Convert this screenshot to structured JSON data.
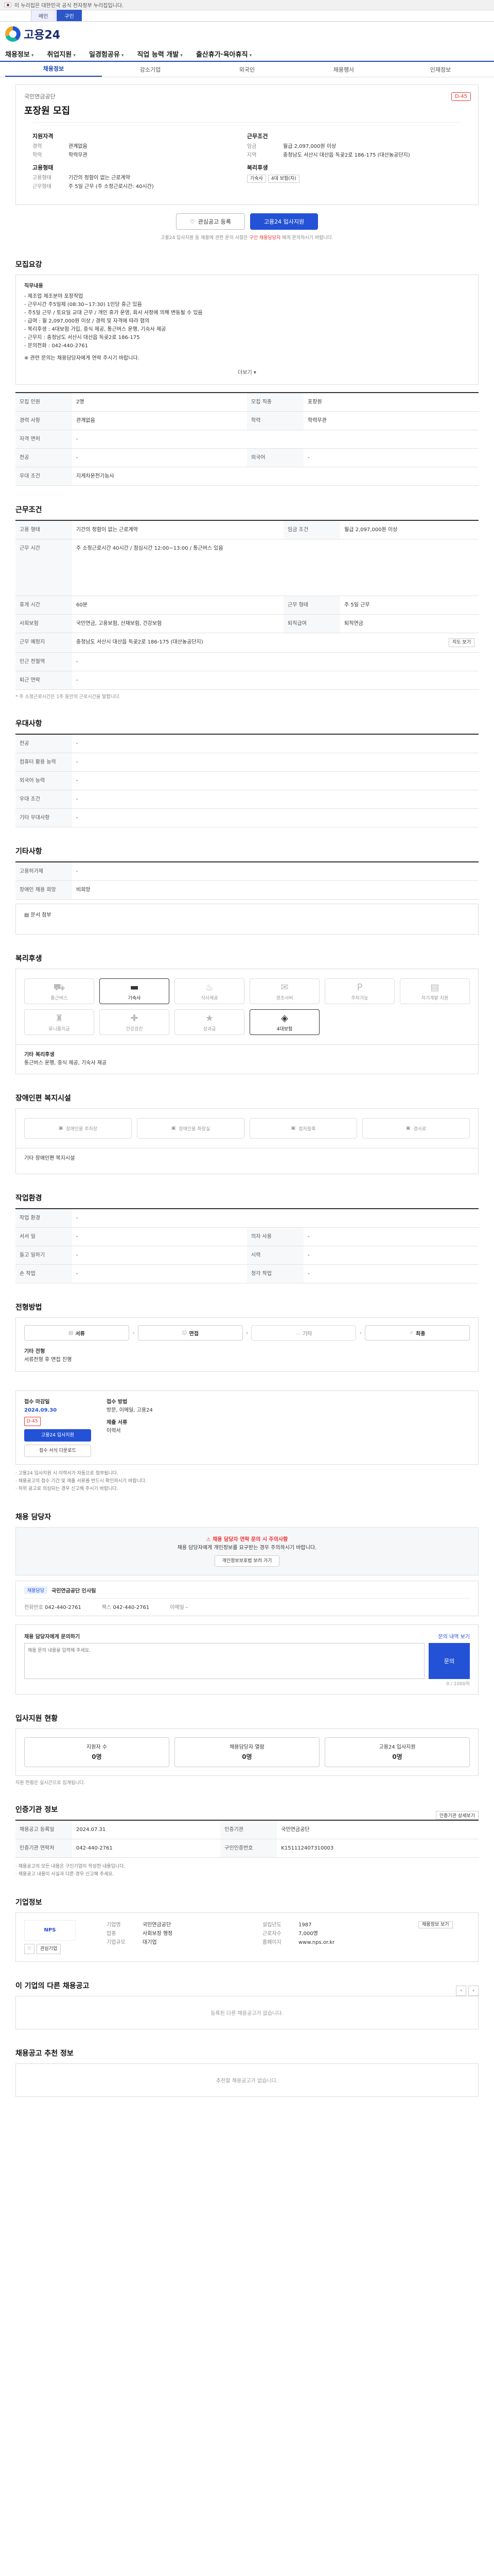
{
  "gov_banner": "이 누리집은 대한민국 공식 전자정부 누리집입니다.",
  "browser_tabs": [
    "메인",
    "구인"
  ],
  "logo": {
    "text": "고용24"
  },
  "gnb": [
    "채용정보",
    "취업지원",
    "일경험공유",
    "직업 능력 개발",
    "출산휴가·육아휴직"
  ],
  "subnav": [
    "채용정보",
    "강소기업",
    "외국인",
    "채용행사",
    "인재정보"
  ],
  "job": {
    "company": "국민연금공단",
    "title": "포장원 모집",
    "badge": "D-45",
    "summary_left_title": "지원자격",
    "summary_left": [
      {
        "k": "경력",
        "v": "관계없음"
      },
      {
        "k": "학력",
        "v": "학력무관"
      }
    ],
    "summary_right_title": "근무조건",
    "summary_right": [
      {
        "k": "임금",
        "v": "월급 2,097,000원 이상"
      },
      {
        "k": "지역",
        "v": "충청남도 서산시 대산읍 독곶2로 186-175 (대산농공단지)"
      }
    ],
    "summary_left2_title": "고용형태",
    "summary_left2": [
      {
        "k": "고용형태",
        "v": "기간의 정함이 없는 근로계약"
      },
      {
        "k": "근무형태",
        "v": "주 5일 근무 (주 소정근로시간: 40시간)"
      }
    ],
    "summary_right2_title": "복리후생",
    "summary_right2": [
      {
        "k": "",
        "v": "기숙사"
      },
      {
        "k": "",
        "v": "4대 보험(자)"
      }
    ]
  },
  "buttons": {
    "like": "관심공고 등록",
    "apply": "고용24 입사지원"
  },
  "apply_note_a": "고용24 입사지원 등 채용에 관한 문의 사항은",
  "apply_note_b": "구인 채용담당자",
  "apply_note_c": "에게 문의하시기 바랍니다.",
  "sections": {
    "recruit": "모집요강",
    "conditions": "근무조건",
    "preference": "우대사항",
    "extra": "기타사항",
    "welfare": "복리후생",
    "disabled": "장애인편 복지시설",
    "env": "작업환경",
    "process": "전형방법",
    "contact": "채용 담당자",
    "apply_status": "입사지원 현황",
    "info": "인증기관 정보",
    "company": "기업정보",
    "other_jobs": "이 기업의 다른 채용공고",
    "recommend": "채용공고 추천 정보"
  },
  "recruit_box": {
    "title": "직무내용",
    "lines": [
      "- 제조업 제조분야 포장작업",
      "- 근무시간 주5일제 (08:30~17:30) 1인당 휴근 있음",
      "- 주5일 근무 / 토요일 교대 근무 / 개인 휴가 운영, 회사 사정에 의해 변동될 수 있음",
      "- 급여 : 월 2,097,000원 이상 / 경력 및 자격에 따라 협의",
      "- 복리후생 : 4대보험 가입, 중식 제공, 통근버스 운행, 기숙사 제공",
      "- 근무지 : 충청남도 서산시 대산읍 독곶2로 186-175",
      "- 문의전화 : 042-440-2761"
    ],
    "note": "※ 관련 문의는 채용담당자에게 연락 주시기 바랍니다.",
    "more": "더보기"
  },
  "recruit_table": [
    {
      "k": "모집 인원",
      "v": "2명",
      "k2": "모집 직종",
      "v2": "포장원"
    },
    {
      "k": "경력 사항",
      "v": "관계없음",
      "k2": "학력",
      "v2": "학력무관"
    },
    {
      "k": "자격 면허",
      "v": "-",
      "k2": "",
      "v2": ""
    },
    {
      "k": "전공",
      "v": "-",
      "k2": "외국어",
      "v2": "-"
    },
    {
      "k": "우대 조건",
      "v": "지게차운전기능사",
      "k2": "",
      "v2": ""
    }
  ],
  "cond_table": [
    {
      "k": "고용 형태",
      "v": "기간의 정함이 없는 근로계약",
      "k2": "임금 조건",
      "v2": "월급 2,097,000원 이상"
    },
    {
      "k": "근무 시간",
      "v": "주 소정근로시간 40시간 / 점심시간 12:00~13:00 / 통근버스 있음",
      "k2": "",
      "v2": ""
    },
    {
      "k": "휴게 시간",
      "v": "60분",
      "k2": "근무 형태",
      "v2": "주 5일 근무"
    },
    {
      "k": "사회보험",
      "v": "국민연금, 고용보험, 산재보험, 건강보험",
      "k2": "퇴직급여",
      "v2": "퇴직연금"
    },
    {
      "k": "근무 예정지",
      "v": "충청남도 서산시 대산읍 독곶2로 186-175 (대산농공단지)",
      "k2": "",
      "v2": ""
    },
    {
      "k": "인근 전철역",
      "v": "-",
      "k2": "",
      "v2": ""
    },
    {
      "k": "퇴근 연락",
      "v": "-",
      "k2": "",
      "v2": ""
    }
  ],
  "map_btn": "지도 보기",
  "cond_note": "* 주 소정근로시간은 1주 동안의 근로시간을 말합니다.",
  "pref_table": [
    {
      "k": "전공",
      "v": "-"
    },
    {
      "k": "컴퓨터 활용 능력",
      "v": "-"
    },
    {
      "k": "외국어 능력",
      "v": "-"
    },
    {
      "k": "우대 조건",
      "v": "-"
    },
    {
      "k": "기타 우대사항",
      "v": "-"
    }
  ],
  "extra_table": [
    {
      "k": "고용허가제",
      "v": "-"
    },
    {
      "k": "장애인 채용 희망",
      "v": "비희망"
    }
  ],
  "extra_link": "문서 첨부",
  "welfare_items": [
    {
      "icon": "car-icon",
      "label": "통근버스",
      "on": false
    },
    {
      "icon": "bed-icon",
      "label": "기숙사",
      "on": true
    },
    {
      "icon": "meal-icon",
      "label": "식사제공",
      "on": false
    },
    {
      "icon": "gift-icon",
      "label": "경조사비",
      "on": false
    },
    {
      "icon": "parking-icon",
      "label": "주차가능",
      "on": false
    },
    {
      "icon": "doc-icon",
      "label": "자기계발 지원",
      "on": false
    },
    {
      "icon": "uniform-icon",
      "label": "유니폼지급",
      "on": false
    },
    {
      "icon": "health-icon",
      "label": "건강검진",
      "on": false
    },
    {
      "icon": "bonus-icon",
      "label": "성과급",
      "on": false
    },
    {
      "icon": "insurance-icon",
      "label": "4대보험",
      "on": true
    }
  ],
  "welfare_sub_title": "기타 복리후생",
  "welfare_sub": "통근버스 운행, 중식 제공, 기숙사 제공",
  "disabled_items": [
    "장애인용 주차장",
    "장애인용 화장실",
    "점자블록",
    "경사로"
  ],
  "disabled_sub": "기타 장애인편 복지시설",
  "env_table": [
    {
      "k": "작업 환경",
      "v": "-",
      "k2": "",
      "v2": ""
    },
    {
      "k": "서서 일",
      "v": "-",
      "k2": "의자 사용",
      "v2": "-"
    },
    {
      "k": "들고 일하기",
      "v": "-",
      "k2": "시력",
      "v2": "-"
    },
    {
      "k": "손 작업",
      "v": "-",
      "k2": "청각 작업",
      "v2": "-"
    }
  ],
  "process_steps": [
    "서류",
    "면접",
    "기타",
    "최종"
  ],
  "process_title": "기타 전형",
  "process_note": "서류전형 후 면접 진행",
  "deadline": {
    "label": "접수 마감일",
    "date": "2024.09.30",
    "dday": "D-45",
    "method_label": "접수 방법",
    "method": "방문, 이메일, 고용24",
    "docs_label": "제출 서류",
    "docs": "이력서",
    "apply_btn": "고용24 입사지원",
    "form_btn": "접수 서식 다운로드"
  },
  "deadline_notes": [
    "고용24 입사지원 시 이력서가 자동으로 첨부됩니다.",
    "채용공고의 접수 기간 및 제출 서류를 반드시 확인하시기 바랍니다.",
    "허위 공고로 의심되는 경우 신고해 주시기 바랍니다."
  ],
  "contact": {
    "warn": "채용 담당자 연락 문의 시 주의사항",
    "text": "채용 담당자에게 개인정보를 요구받는 경우 주의하시기 바랍니다.",
    "btn": "개인정보보호법 보러 가기",
    "tag": "채용담당",
    "name": "국민연금공단 인사팀",
    "phone_label": "전화번호",
    "phone": "042-440-2761",
    "fax_label": "팩스",
    "fax": "042-440-2761",
    "email_label": "이메일",
    "email": "-"
  },
  "qna": {
    "title": "채용 담당자에게 문의하기",
    "sub": "문의 내역 보기",
    "placeholder": "채용 문의 내용을 입력해 주세요.",
    "btn": "문의",
    "count": "0 / 1000자"
  },
  "apply_status": [
    {
      "label": "지원자 수",
      "value": "0명"
    },
    {
      "label": "채용담당자 열람",
      "value": "0명"
    },
    {
      "label": "고용24 입사지원",
      "value": "0명"
    }
  ],
  "apply_status_note": "지원 현황은 실시간으로 집계됩니다.",
  "info_btn": "인증기관 상세보기",
  "info_table": [
    {
      "k": "채용공고 등록일",
      "v": "2024.07.31",
      "k2": "인증기관",
      "v2": "국민연금공단"
    },
    {
      "k": "인증기관 연락처",
      "v": "042-440-2761",
      "k2": "구인인증번호",
      "v2": "K151112407310003"
    }
  ],
  "info_notes": [
    "채용공고의 모든 내용은 구인기업이 작성한 내용입니다.",
    "채용공고 내용이 사실과 다른 경우 신고해 주세요."
  ],
  "company": {
    "logo": "NPS",
    "like": "관심기업",
    "sub": "기업정보",
    "rows": [
      {
        "k": "기업명",
        "v": "국민연금공단"
      },
      {
        "k": "업종",
        "v": "사회보장 행정"
      },
      {
        "k": "기업규모",
        "v": "대기업"
      },
      {
        "k": "설립년도",
        "v": "1987"
      },
      {
        "k": "근로자수",
        "v": "7,000명"
      },
      {
        "k": "홈페이지",
        "v": "www.nps.or.kr"
      }
    ],
    "map_btn": "채용정보 보기"
  },
  "other_empty": "등록된 다른 채용공고가 없습니다.",
  "recommend_empty": "추천할 채용공고가 없습니다."
}
